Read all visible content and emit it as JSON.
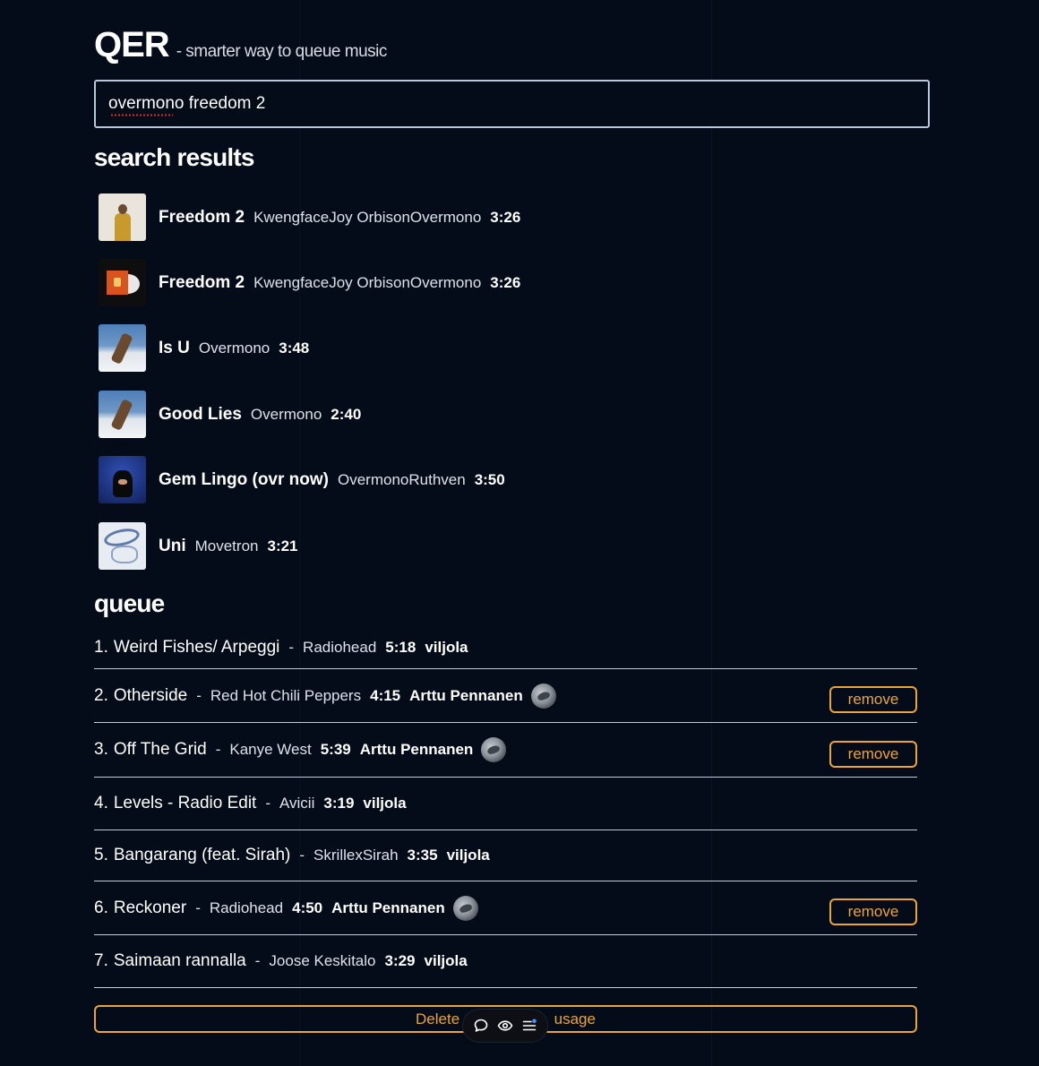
{
  "header": {
    "logo": "QER",
    "tagline": "- smarter way to queue music"
  },
  "search": {
    "value": "overmono freedom 2",
    "placeholder": ""
  },
  "results_section": {
    "title": "search results"
  },
  "results": [
    {
      "title": "Freedom 2",
      "artists": "KwengfaceJoy OrbisonOvermono",
      "duration": "3:26",
      "cover_icon": "person-yellow-jacket-cover"
    },
    {
      "title": "Freedom 2",
      "artists": "KwengfaceJoy OrbisonOvermono",
      "duration": "3:26",
      "cover_icon": "vinyl-record-cover"
    },
    {
      "title": "Is U",
      "artists": "Overmono",
      "duration": "3:48",
      "cover_icon": "snow-figure-cover"
    },
    {
      "title": "Good Lies",
      "artists": "Overmono",
      "duration": "2:40",
      "cover_icon": "snow-figure-cover"
    },
    {
      "title": "Gem Lingo (ovr now)",
      "artists": "OvermonoRuthven",
      "duration": "3:50",
      "cover_icon": "dog-blue-cover"
    },
    {
      "title": "Uni",
      "artists": "Movetron",
      "duration": "3:21",
      "cover_icon": "abstract-white-cover"
    }
  ],
  "queue_section": {
    "title": "queue"
  },
  "queue": [
    {
      "num": "1.",
      "title": "Weird Fishes/ Arpeggi",
      "sep": "-",
      "artist": "Radiohead",
      "duration": "5:18",
      "user": "viljola",
      "avatar": false,
      "remove": false
    },
    {
      "num": "2.",
      "title": "Otherside",
      "sep": "-",
      "artist": "Red Hot Chili Peppers",
      "duration": "4:15",
      "user": "Arttu Pennanen",
      "avatar": true,
      "remove": true
    },
    {
      "num": "3.",
      "title": "Off The Grid",
      "sep": "-",
      "artist": "Kanye West",
      "duration": "5:39",
      "user": "Arttu Pennanen",
      "avatar": true,
      "remove": true
    },
    {
      "num": "4.",
      "title": "Levels - Radio Edit",
      "sep": "-",
      "artist": "Avicii",
      "duration": "3:19",
      "user": "viljola",
      "avatar": false,
      "remove": false
    },
    {
      "num": "5.",
      "title": "Bangarang (feat. Sirah)",
      "sep": "-",
      "artist": "SkrillexSirah",
      "duration": "3:35",
      "user": "viljola",
      "avatar": false,
      "remove": false
    },
    {
      "num": "6.",
      "title": "Reckoner",
      "sep": "-",
      "artist": "Radiohead",
      "duration": "4:50",
      "user": "Arttu Pennanen",
      "avatar": true,
      "remove": true
    },
    {
      "num": "7.",
      "title": "Saimaan rannalla",
      "sep": "-",
      "artist": "Joose Keskitalo",
      "duration": "3:29",
      "user": "viljola",
      "avatar": false,
      "remove": false
    }
  ],
  "remove_label": "remove",
  "delete_button": {
    "label_left": "Delete",
    "label_right": "usage"
  },
  "toolbar": {
    "icons": [
      "comment-icon",
      "eye-icon",
      "menu-icon"
    ]
  },
  "colors": {
    "background": "#050c19",
    "accent": "#eaa534",
    "search_border": "#b9c7dd",
    "text": "#ffffff",
    "muted_text": "#dde2ea"
  }
}
